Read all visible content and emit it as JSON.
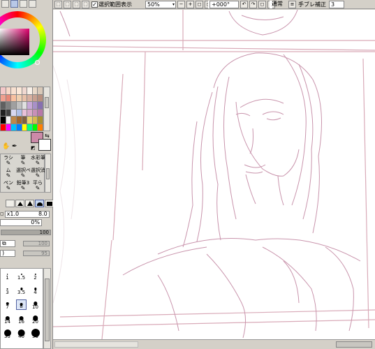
{
  "toolbar": {
    "show_selection_label": "選択範囲表示",
    "show_selection_checked": true,
    "zoom_value": "50%",
    "rotation_value": "+000°",
    "mode_value": "通常",
    "stabilizer_label": "手ブレ補正",
    "stabilizer_value": "3"
  },
  "colors": {
    "foreground": "#cc8aa8",
    "background": "#ffffff",
    "sketch_line": "#c994ac",
    "guide_line": "#d9aab8"
  },
  "swatches": [
    "#f4c8c8",
    "#f8d8c8",
    "#f8e0d0",
    "#fce8d8",
    "#f0d8d0",
    "#f8f0e8",
    "#e8d8c8",
    "#d8c8b8",
    "#f0a090",
    "#e88878",
    "#f8c0a0",
    "#f0d0b0",
    "#e8c0a8",
    "#d8b0a0",
    "#c8a090",
    "#b89080",
    "#606060",
    "#808080",
    "#a0a0a0",
    "#c0c0c0",
    "#e0e0e0",
    "#c8a8d8",
    "#a890c8",
    "#8870b0",
    "#202020",
    "#404040",
    "#d8d8f0",
    "#b0c0e8",
    "#e8c0d8",
    "#d8a8c8",
    "#c890b8",
    "#b878a8",
    "#000000",
    "#f0f0f0",
    "#c08848",
    "#a06830",
    "#806040",
    "#e8d070",
    "#d8b850",
    "#a89030",
    "#ff0000",
    "#ff00ff",
    "#00c0ff",
    "#0080ff",
    "#ffff00",
    "#00ff80",
    "#00ff00",
    "#ff8000"
  ],
  "tools": [
    {
      "label": "ラシ",
      "icon": "brush-icon"
    },
    {
      "label": "筆",
      "icon": "pen-icon"
    },
    {
      "label": "水彩筆",
      "icon": "watercolor-icon"
    },
    {
      "label": "ム",
      "icon": "eraser-icon"
    },
    {
      "label": "選択ペン",
      "icon": "selpen-icon"
    },
    {
      "label": "選択消",
      "icon": "selerase-icon"
    },
    {
      "label": "ペン",
      "icon": "pencil-icon"
    },
    {
      "label": "鉛筆3",
      "icon": "pencil3-icon"
    },
    {
      "label": "平ら",
      "icon": "flat-icon"
    }
  ],
  "brush": {
    "size_mult": "x1.0",
    "size_value": "8.0",
    "min_size": "0%",
    "density": "100",
    "texture_value_a": "100",
    "texture_value_b": "95"
  },
  "brush_sizes": [
    {
      "label": "1"
    },
    {
      "label": "1.5"
    },
    {
      "label": "2"
    },
    {
      "label": "3"
    },
    {
      "label": "3.5"
    },
    {
      "label": "4"
    },
    {
      "label": "7"
    },
    {
      "label": "8"
    },
    {
      "label": "10"
    },
    {
      "label": "14"
    },
    {
      "label": "16"
    },
    {
      "label": "20"
    },
    {
      "label": "35"
    },
    {
      "label": "40"
    },
    {
      "label": "50"
    }
  ],
  "brush_size_selected_index": 7
}
